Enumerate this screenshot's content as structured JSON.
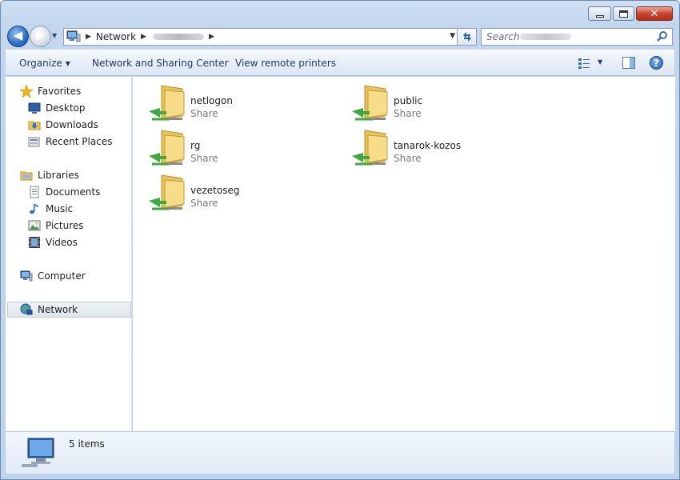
{
  "window": {
    "caption_buttons": {
      "minimize": "minimize",
      "maximize": "maximize",
      "close": "close"
    }
  },
  "navigation": {
    "breadcrumb": [
      "Network"
    ],
    "search_placeholder": "Search"
  },
  "commandbar": {
    "organize": "Organize",
    "network_sharing": "Network and Sharing Center",
    "remote_printers": "View remote printers"
  },
  "sidebar": {
    "favorites": {
      "label": "Favorites",
      "items": [
        {
          "label": "Desktop",
          "icon": "desktop-icon"
        },
        {
          "label": "Downloads",
          "icon": "downloads-icon"
        },
        {
          "label": "Recent Places",
          "icon": "recent-places-icon"
        }
      ]
    },
    "libraries": {
      "label": "Libraries",
      "items": [
        {
          "label": "Documents",
          "icon": "documents-icon"
        },
        {
          "label": "Music",
          "icon": "music-icon"
        },
        {
          "label": "Pictures",
          "icon": "pictures-icon"
        },
        {
          "label": "Videos",
          "icon": "videos-icon"
        }
      ]
    },
    "computer": "Computer",
    "network": "Network"
  },
  "content": {
    "items": [
      {
        "name": "netlogon",
        "type": "Share"
      },
      {
        "name": "public",
        "type": "Share"
      },
      {
        "name": "rg",
        "type": "Share"
      },
      {
        "name": "tanarok-kozos",
        "type": "Share"
      },
      {
        "name": "vezetoseg",
        "type": "Share"
      }
    ]
  },
  "details": {
    "count": "5 items"
  },
  "colors": {
    "accent": "#1e395b",
    "selection": "#dfe5ec",
    "share_arrow": "#3fa83f"
  }
}
